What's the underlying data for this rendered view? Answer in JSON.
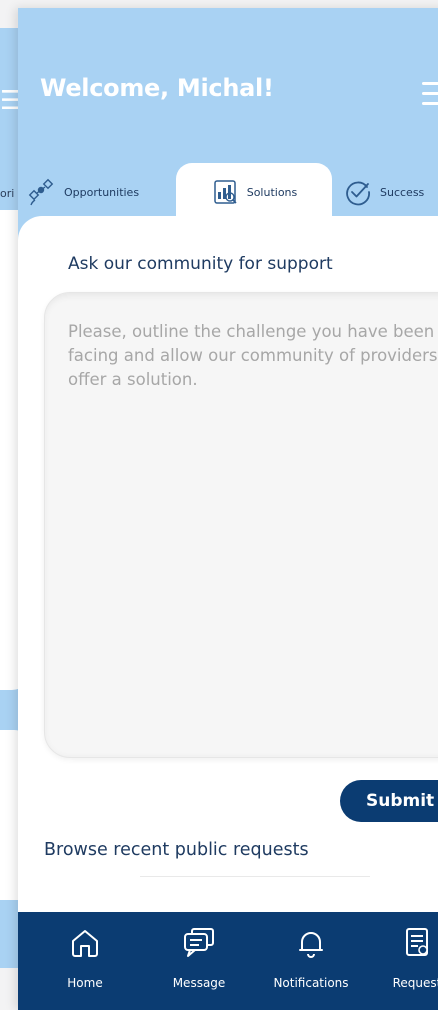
{
  "background_screen": {
    "tab_fragment": "ori"
  },
  "header": {
    "welcome": "Welcome, Michal!",
    "menu_icon": "hamburger-menu-icon"
  },
  "tabs": [
    {
      "label": "Opportunities",
      "icon": "satellite-icon",
      "active": false
    },
    {
      "label": "Solutions",
      "icon": "chart-document-icon",
      "active": true
    },
    {
      "label": "Success",
      "icon": "check-circle-icon",
      "active": false
    }
  ],
  "main": {
    "ask_title": "Ask our community for support",
    "textarea_placeholder": "Please, outline the challenge you have been facing and allow our community of providers offer a solution.",
    "submit_label": "Submit",
    "browse_label": "Browse recent public requests"
  },
  "bottom_nav": [
    {
      "label": "Home",
      "icon": "home-icon"
    },
    {
      "label": "Message",
      "icon": "chat-bubbles-icon"
    },
    {
      "label": "Notifications",
      "icon": "bell-icon"
    },
    {
      "label": "Request",
      "icon": "document-list-icon"
    }
  ],
  "colors": {
    "header_bg": "#a9d2f3",
    "primary": "#0b3c72",
    "text_dark": "#1f3b61",
    "placeholder": "#a7a7a7"
  }
}
